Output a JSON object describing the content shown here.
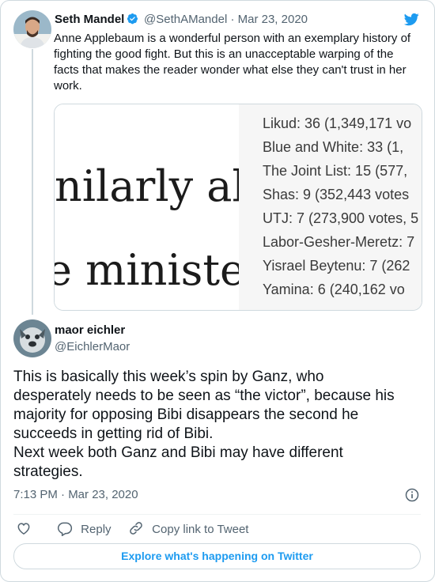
{
  "quoted_tweet": {
    "author_name": "Seth Mandel",
    "handle_date": "@SethAMandel · Mar 23, 2020",
    "text": "Anne Applebaum is a wonderful person with an exemplary history of fighting the good fight. But this is an unacceptable warping of the facts that makes the reader wonder what else they can't trust in her work.",
    "image": {
      "left_lines": [
        "nilarly ab",
        "e ministe"
      ],
      "right_lines": [
        "Likud: 36   (1,349,171 vo",
        "Blue and White: 33   (1,",
        "The Joint List: 15   (577,",
        "Shas: 9   (352,443 votes",
        "UTJ: 7  (273,900 votes, 5",
        "Labor-Gesher-Meretz: 7",
        "Yisrael Beytenu: 7   (262",
        "Yamina: 6   (240,162 vo"
      ]
    }
  },
  "tweet": {
    "author_name": "maor eichler",
    "handle": "@EichlerMaor",
    "text_lines": [
      "This is basically this week’s spin by Ganz, who",
      "desperately needs to be seen as “the victor”, because his",
      "majority for opposing Bibi disappears the second he",
      "succeeds in getting rid of Bibi.",
      "Next week both Ganz and Bibi may have different",
      "strategies."
    ],
    "timestamp": "7:13 PM · Mar 23, 2020"
  },
  "actions": {
    "reply": "Reply",
    "copy_link": "Copy link to Tweet"
  },
  "explore_label": "Explore what's happening on Twitter",
  "colors": {
    "twitter_blue": "#1d9bf0",
    "secondary_text": "#536471",
    "border": "#cfd9de"
  }
}
